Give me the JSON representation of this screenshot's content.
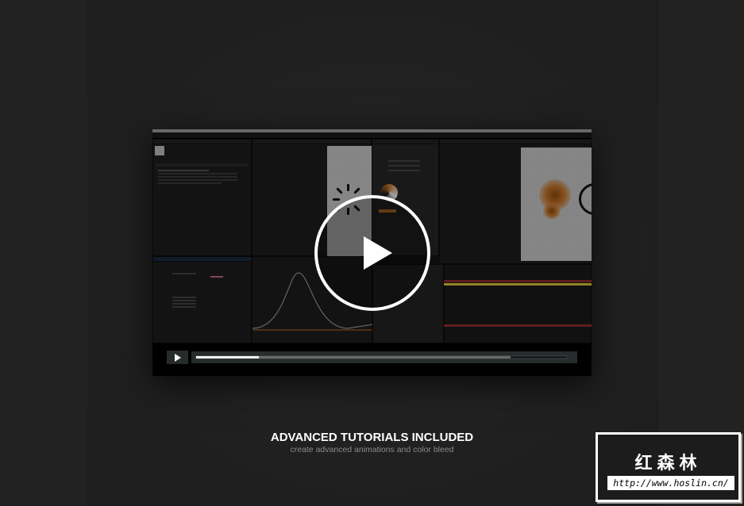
{
  "video": {
    "progress_played": 0.17,
    "progress_buffered": 0.85,
    "play_button_icon": "play-icon"
  },
  "caption": {
    "headline": "ADVANCED TUTORIALS INCLUDED",
    "subtitle": "create advanced animations and color bleed"
  },
  "watermark": {
    "title": "红森林",
    "url": "http://www.hoslin.cn/"
  },
  "colors": {
    "background": "#222222",
    "timeline_yellow": "#d8c53a",
    "timeline_red": "#8e2a2a",
    "accent_blue": "#2d7bd6",
    "orange_bleed": "#c2732a"
  }
}
